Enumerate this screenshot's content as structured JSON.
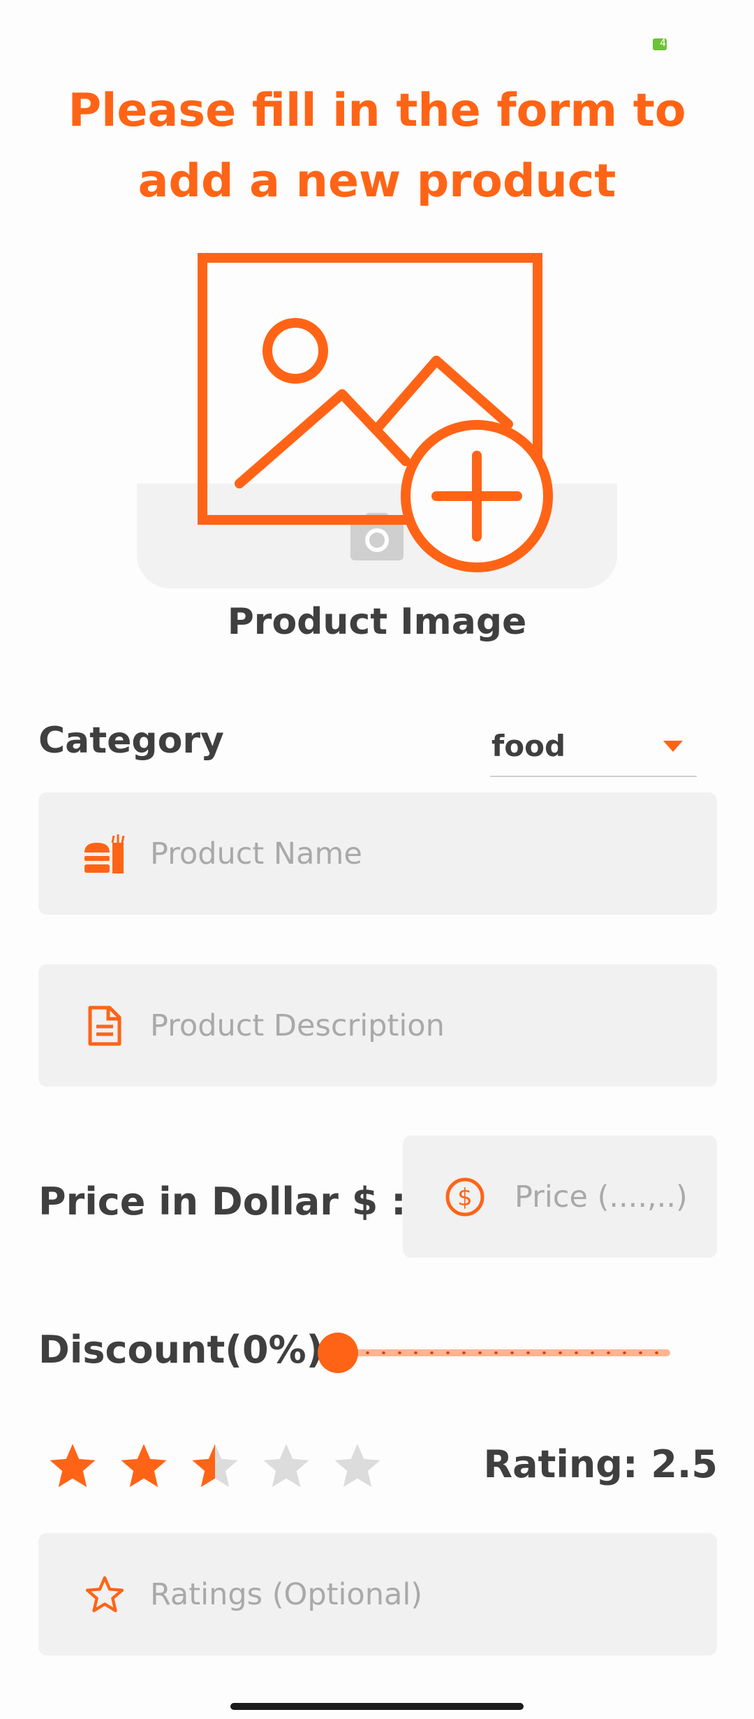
{
  "status_bar": {
    "battery_level": "4",
    "battery_color": "#6cc335"
  },
  "title": "Please fill in the form to add a new product",
  "product_image": {
    "label": "Product Image",
    "icon": "image-add-icon"
  },
  "category": {
    "label": "Category",
    "selected": "food"
  },
  "fields": {
    "product_name": {
      "placeholder": "Product Name",
      "icon": "food-icon"
    },
    "product_description": {
      "placeholder": "Product Description",
      "icon": "document-icon"
    },
    "price": {
      "label": "Price in Dollar $ :",
      "placeholder": "Price (....,..)",
      "icon": "dollar-circle-icon"
    },
    "ratings": {
      "placeholder": "Ratings (Optional)",
      "icon": "star-outline-icon"
    }
  },
  "discount": {
    "label": "Discount(0%)",
    "value": 0
  },
  "rating": {
    "label": "Rating: 2.5",
    "value": 2.5,
    "max": 5
  },
  "colors": {
    "accent": "#ff6416",
    "text": "#3f3f3f",
    "placeholder": "#a9a9a9",
    "field_bg": "#f1f1f1",
    "star_empty": "#dcdcdc"
  }
}
